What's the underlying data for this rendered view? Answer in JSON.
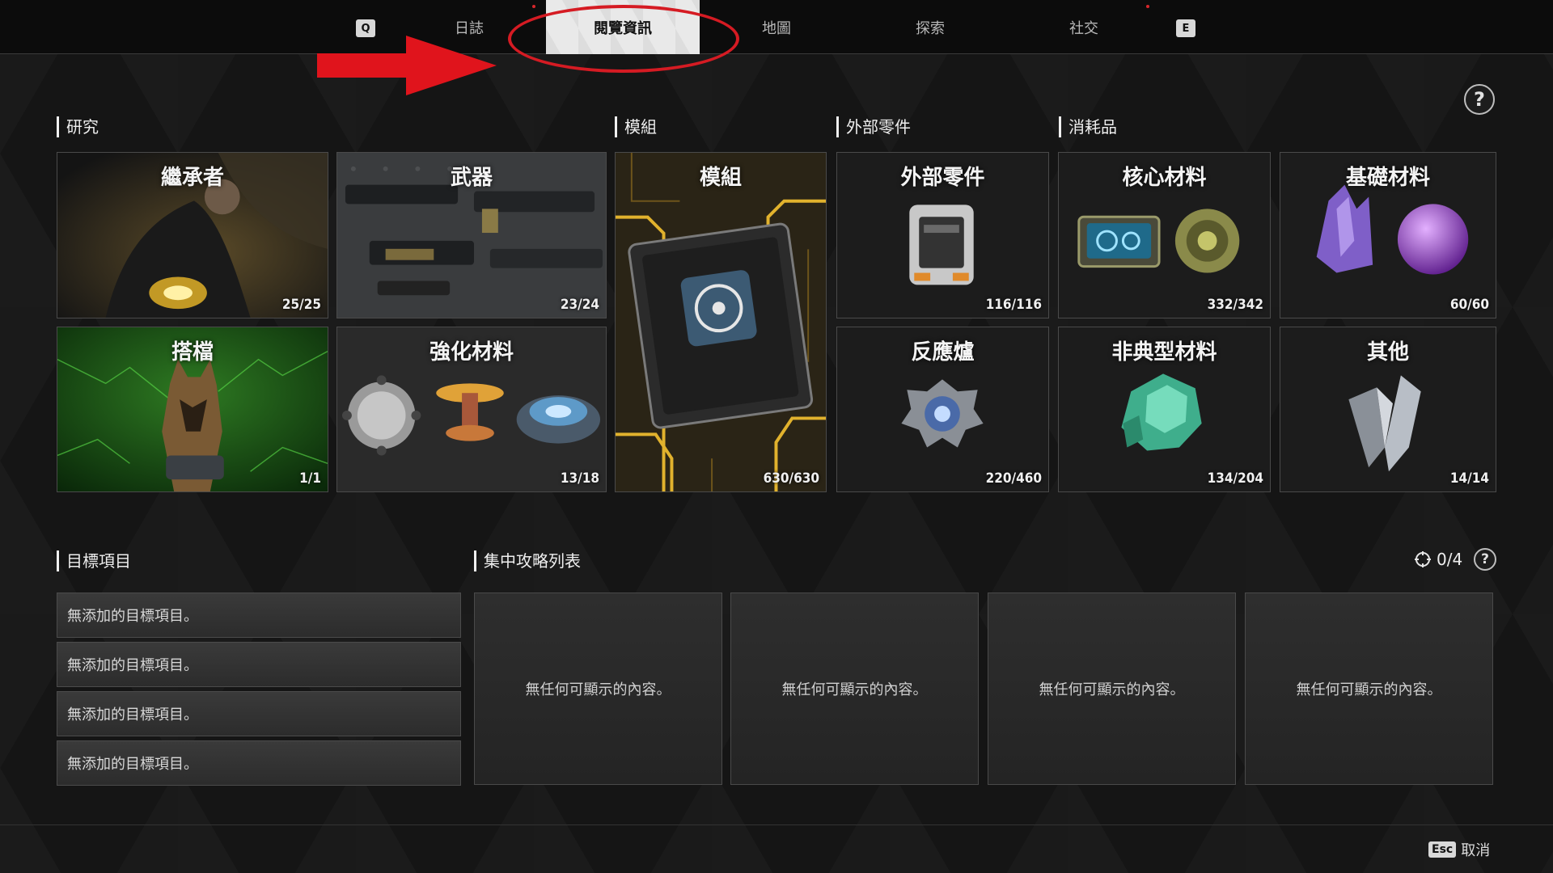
{
  "nav": {
    "prev_key": "Q",
    "next_key": "E",
    "tabs": [
      {
        "label": "日誌",
        "active": false
      },
      {
        "label": "閱覽資訊",
        "active": true
      },
      {
        "label": "地圖",
        "active": false
      },
      {
        "label": "探索",
        "active": false
      },
      {
        "label": "社交",
        "active": false
      }
    ]
  },
  "help_label": "?",
  "sections": {
    "research": "研究",
    "module": "模組",
    "external": "外部零件",
    "consumables": "消耗品"
  },
  "cards": {
    "descendant": {
      "title": "繼承者",
      "count": "25/25"
    },
    "weapon": {
      "title": "武器",
      "count": "23/24"
    },
    "module": {
      "title": "模組",
      "count": "630/630"
    },
    "external": {
      "title": "外部零件",
      "count": "116/116"
    },
    "core": {
      "title": "核心材料",
      "count": "332/342"
    },
    "basic": {
      "title": "基礎材料",
      "count": "60/60"
    },
    "partner": {
      "title": "搭檔",
      "count": "1/1"
    },
    "enhance": {
      "title": "強化材料",
      "count": "13/18"
    },
    "reactor": {
      "title": "反應爐",
      "count": "220/460"
    },
    "atypical": {
      "title": "非典型材料",
      "count": "134/204"
    },
    "other": {
      "title": "其他",
      "count": "14/14"
    }
  },
  "targets": {
    "title": "目標項目",
    "items": [
      "無添加的目標項目。",
      "無添加的目標項目。",
      "無添加的目標項目。",
      "無添加的目標項目。"
    ]
  },
  "guide": {
    "title": "集中攻略列表",
    "counter": "0/4",
    "slots": [
      "無任何可顯示的內容。",
      "無任何可顯示的內容。",
      "無任何可顯示的內容。",
      "無任何可顯示的內容。"
    ]
  },
  "footer": {
    "esc_key": "Esc",
    "cancel_label": "取消"
  },
  "colors": {
    "accent_red": "#d51b23",
    "active_tab_bg": "#e9e9e9"
  }
}
